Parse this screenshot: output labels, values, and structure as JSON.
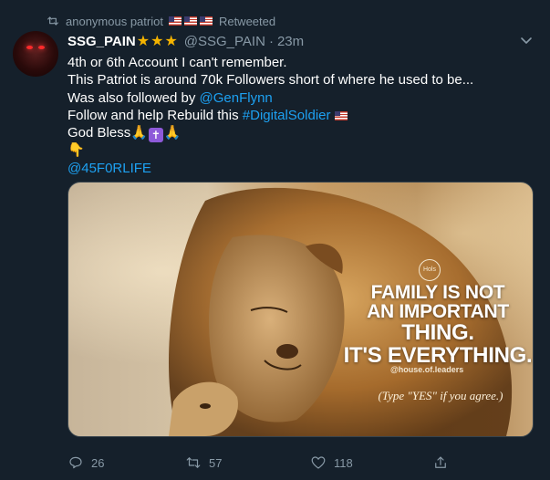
{
  "retweet": {
    "user": "anonymous patriot",
    "label": "Retweeted",
    "flag_count": 3
  },
  "tweet": {
    "display_name": "SSG_PAIN",
    "badge_stars": "★★★",
    "handle": "@SSG_PAIN",
    "separator": "·",
    "time": "23m",
    "lines": {
      "l1": "4th or 6th Account I can't remember.",
      "l2": "This Patriot is around 70k Followers short of where he used to be...",
      "l3_prefix": "Was also followed by ",
      "l3_mention": "@GenFlynn",
      "l4_prefix": "Follow and help Rebuild this ",
      "l4_hashtag": "#DigitalSoldier",
      "l5": "God Bless",
      "l7_mention": "@45F0RLIFE"
    },
    "emoji": {
      "pray": "🙏",
      "cross": "✝",
      "point_down": "👇"
    }
  },
  "media": {
    "logo_text": "Hols",
    "quote_lines": [
      "FAMILY IS NOT",
      "AN IMPORTANT",
      "THING.",
      "IT'S EVERYTHING."
    ],
    "credit": "@house.of.leaders",
    "cta": "(Type \"YES\" if you agree.)"
  },
  "actions": {
    "replies": "26",
    "retweets": "57",
    "likes": "118"
  },
  "icons": {
    "retweet_indicator": "retweet-icon",
    "menu": "chevron-down-icon",
    "reply": "reply-icon",
    "retweet": "retweet-icon",
    "like": "heart-icon",
    "share": "share-icon"
  },
  "colors": {
    "background": "#15202b",
    "text_primary": "#ffffff",
    "text_secondary": "#8899a6",
    "link": "#1da1f2",
    "star": "#f5b400"
  }
}
